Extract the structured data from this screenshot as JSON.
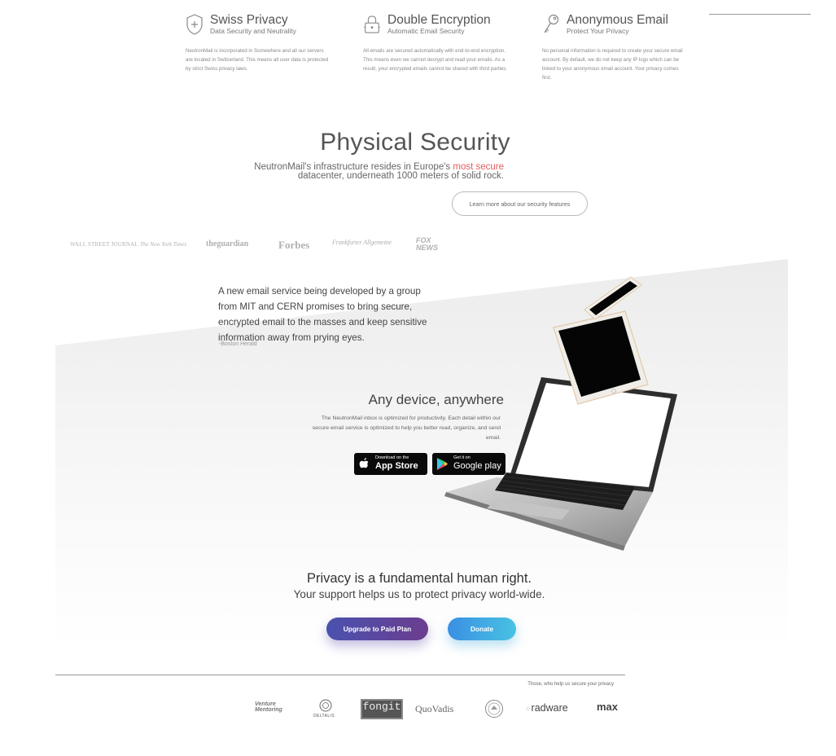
{
  "features": [
    {
      "icon": "shield-plus-icon",
      "title": "Swiss Privacy",
      "subtitle": "Data Security and Neutrality",
      "description": "NeutronMail is incorporated in Somewhere and all our servers are located in Switzerland. This means all user data is protected by strict Swiss privacy laws."
    },
    {
      "icon": "padlock-icon",
      "title": "Double Encryption",
      "subtitle": "Automatic Email Security",
      "description": "All emails are secured automatically with end-to-end encryption. This means even we cannot decrypt and read your emails. As a result, your encrypted emails cannot be shared with third parties."
    },
    {
      "icon": "key-icon",
      "title": "Anonymous Email",
      "subtitle": "Protect Your Privacy",
      "description": "No personal information is required to create your secure email account. By default, we do not keep any IP logs which can be linked to your anonymous email account. Your privacy comes first."
    }
  ],
  "physical": {
    "title": "Physical Security",
    "text_before": "NeutronMail's infrastructure resides in Europe's ",
    "highlight": "most secure",
    "text_after": " datacenter, underneath 1000 meters of solid rock.",
    "highlight_color": "#e8595d",
    "button": "Learn more about our security features"
  },
  "press": [
    "WALL STREET JOURNAL",
    "The New York Times",
    "theguardian",
    "Forbes",
    "Frankfurter Allgemeine",
    "FOX NEWS"
  ],
  "quote": {
    "text": "A new email service being developed by a group from MIT and CERN promises to bring secure, encrypted email to the masses and keep sensitive information away from prying eyes.",
    "source": "-Boston Herald"
  },
  "devices": {
    "title": "Any device, anywhere",
    "text": "The NeutronMail inbox is optimized for productivity. Each detail within our secure email service is optimized to help you better read, organize, and send email.",
    "app_store": {
      "small": "Download on the",
      "big": "App Store"
    },
    "google_play": {
      "small": "Get it on",
      "big": "Google play"
    }
  },
  "cta": {
    "title": "Privacy is a fundamental human right.",
    "subtitle": "Your support helps us to protect privacy world-wide.",
    "upgrade": "Upgrade to Paid Plan",
    "donate": "Donate",
    "upgrade_color": "#5a48a0",
    "donate_color": "#3fa8e3"
  },
  "sponsors": {
    "caption": "Those, who help us secure your privacy",
    "items": [
      "Venture Mentoring",
      "DELTALIS",
      "fongit",
      "QuoVadis",
      "radware",
      "max"
    ]
  }
}
